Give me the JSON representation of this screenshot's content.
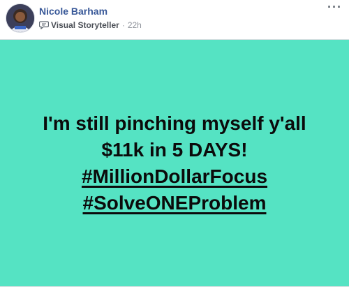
{
  "post": {
    "author_name": "Nicole Barham",
    "badge_icon": "speech-bubble-icon",
    "badge_label": "Visual Storyteller",
    "separator": "·",
    "timestamp": "22h",
    "more_options_icon": "ellipsis-icon",
    "more_options_label": "···",
    "avatar_icon": "profile-photo"
  },
  "banner": {
    "background_color": "#55e3c3",
    "text_color": "#0b0b0b",
    "line1": "I'm still pinching myself y'all",
    "line2": "$11k in 5 DAYS!",
    "hashtag1": "#MillionDollarFocus",
    "hashtag2": "#SolveONEProblem"
  }
}
